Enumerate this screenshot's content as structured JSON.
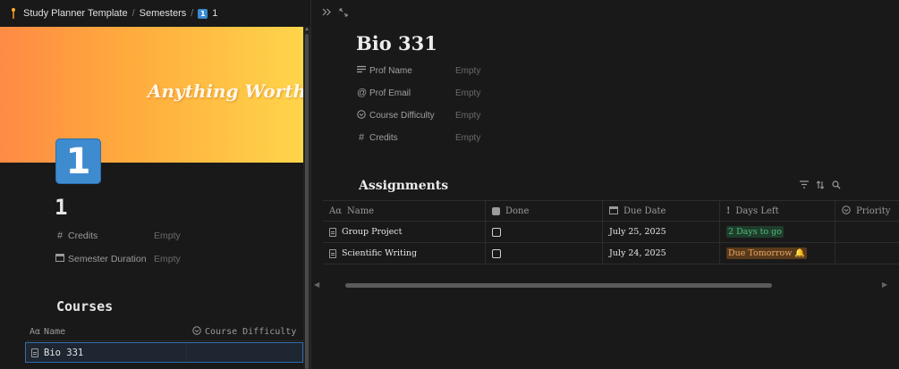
{
  "breadcrumb": {
    "items": [
      "Study Planner Template",
      "Semesters",
      "1"
    ],
    "separator": "/",
    "last_icon": "1"
  },
  "left": {
    "cover_text": "Anything Worth Having",
    "page_icon": "1",
    "title": "1",
    "properties": [
      {
        "label": "Credits",
        "value": "Empty",
        "icon": "hash-icon"
      },
      {
        "label": "Semester Duration",
        "value": "Empty",
        "icon": "calendar-icon"
      }
    ],
    "courses": {
      "heading": "Courses",
      "columns": [
        "Name",
        "Course Difficulty"
      ],
      "name_icon": "Aα",
      "rows": [
        {
          "name": "Bio 331",
          "difficulty": ""
        }
      ]
    }
  },
  "right": {
    "title": "Bio 331",
    "properties": [
      {
        "label": "Prof Name",
        "value": "Empty",
        "icon": "text-icon"
      },
      {
        "label": "Prof Email",
        "value": "Empty",
        "icon": "at-icon"
      },
      {
        "label": "Course Difficulty",
        "value": "Empty",
        "icon": "select-icon"
      },
      {
        "label": "Credits",
        "value": "Empty",
        "icon": "hash-icon"
      }
    ],
    "assignments": {
      "heading": "Assignments",
      "columns": [
        "Name",
        "Done",
        "Due Date",
        "Days Left",
        "Priority"
      ],
      "rows": [
        {
          "name": "Group Project",
          "done": false,
          "due": "July 25, 2025",
          "days_left": "2 Days to go",
          "days_left_color": "#4fbf78"
        },
        {
          "name": "Scientific Writing",
          "done": false,
          "due": "July 24, 2025",
          "days_left": "Due Tomorrow 🔔",
          "days_left_color": "#e5a665"
        }
      ]
    }
  },
  "colors": {
    "background": "#191919",
    "accent_blue": "#3f8bd0",
    "cover_start": "#ff8a45",
    "cover_end": "#ffd54a"
  }
}
